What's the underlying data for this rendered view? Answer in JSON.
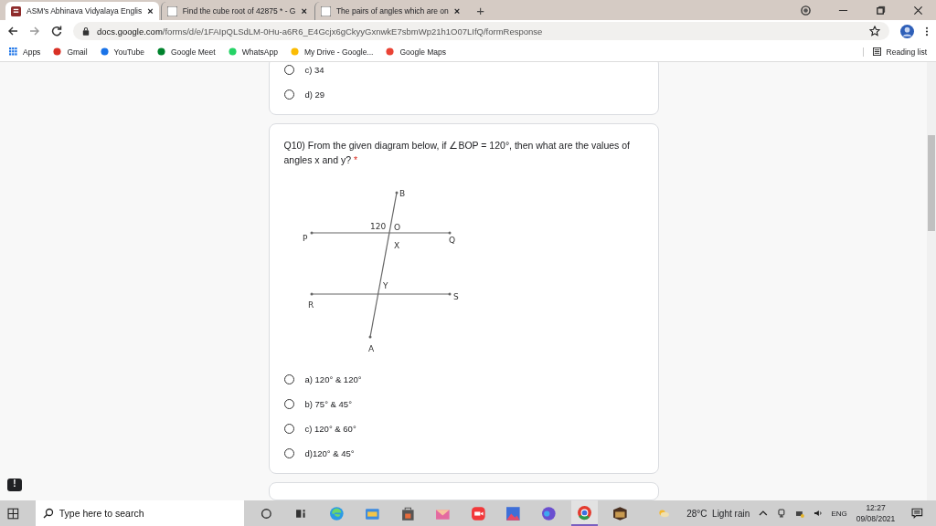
{
  "browser": {
    "tabs": [
      {
        "title": "ASM's Abhinava Vidyalaya Englis",
        "selected": true,
        "close": "×"
      },
      {
        "title": "Find the cube root of 42875 * - G",
        "selected": false,
        "close": "×"
      },
      {
        "title": "The pairs of angles which are on",
        "selected": false,
        "close": "×"
      }
    ],
    "new_tab": "+",
    "address": {
      "host": "docs.google.com",
      "path": "/forms/d/e/1FAIpQLSdLM-0Hu-a6R6_E4Gcjx6gCkyyGxnwkE7sbmWp21h1O07LIfQ/formResponse"
    },
    "bookmarks": [
      {
        "label": "Apps"
      },
      {
        "label": "Gmail"
      },
      {
        "label": "YouTube"
      },
      {
        "label": "Google Meet"
      },
      {
        "label": "WhatsApp"
      },
      {
        "label": "My Drive - Google..."
      },
      {
        "label": "Google Maps"
      }
    ],
    "reading_list": "Reading list"
  },
  "form": {
    "previous_options": [
      {
        "label": "c) 34",
        "selected": false
      },
      {
        "label": "d) 29",
        "selected": false
      }
    ],
    "question": {
      "text": "Q10) From the given diagram below, if ∠BOP = 120°, then what are the values of angles x and y?",
      "required_mark": "*",
      "diagram_labels": {
        "B": "B",
        "O": "O",
        "angle": "120",
        "P": "P",
        "Q": "Q",
        "X": "X",
        "Y": "Y",
        "R": "R",
        "S": "S",
        "A": "A"
      },
      "options": [
        {
          "label": "a) 120° & 120°",
          "selected": false
        },
        {
          "label": "b) 75° & 45°",
          "selected": false
        },
        {
          "label": "c) 120° & 60°",
          "selected": false
        },
        {
          "label": "d)120° & 45°",
          "selected": false
        }
      ]
    }
  },
  "feedback_badge": "!",
  "taskbar": {
    "search_placeholder": "Type here to search",
    "weather": "28°C  Light rain",
    "language": "ENG",
    "time": "12:27",
    "date": "09/08/2021"
  }
}
